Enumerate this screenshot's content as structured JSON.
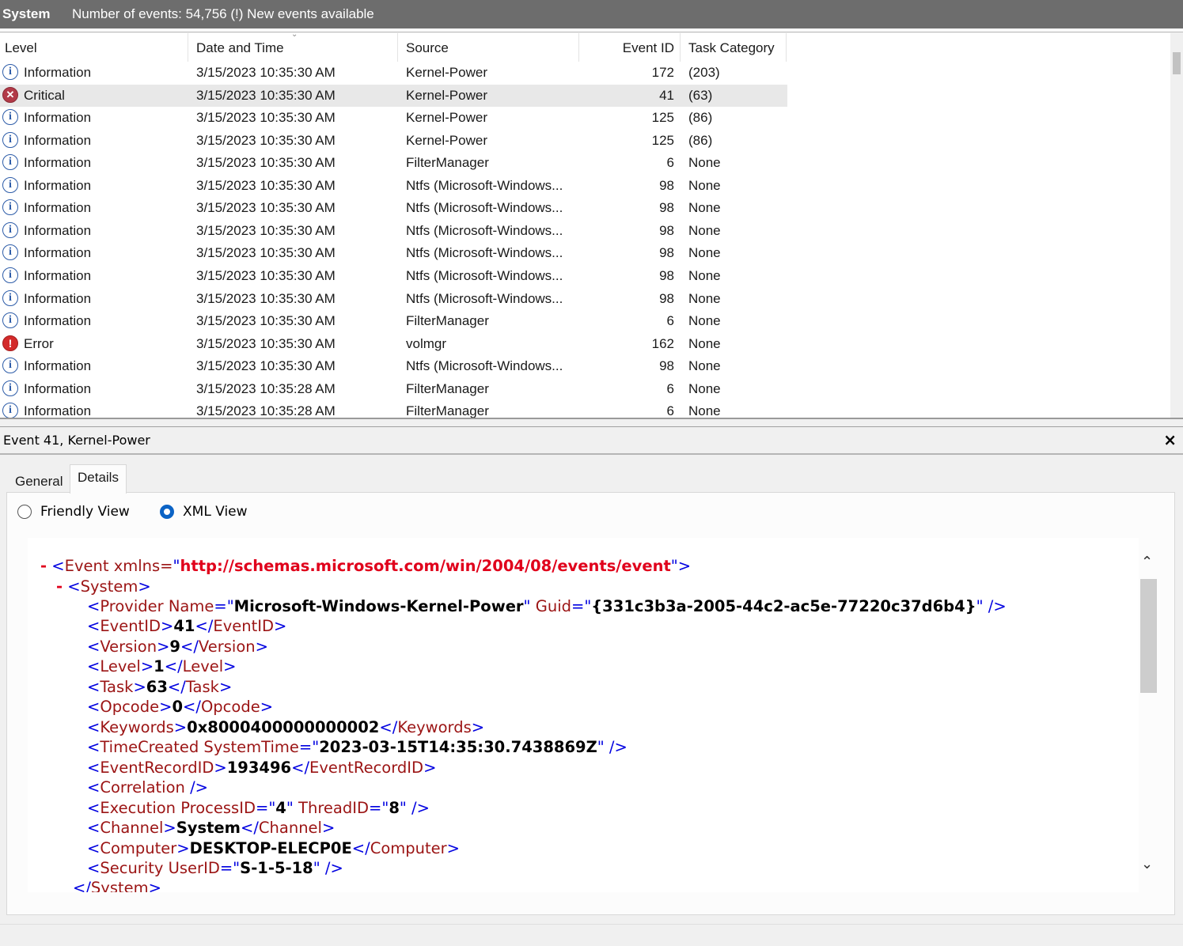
{
  "topbar": {
    "title": "System",
    "info": "Number of events: 54,756 (!) New events available"
  },
  "grid": {
    "headers": {
      "level": "Level",
      "date": "Date and Time",
      "source": "Source",
      "event_id": "Event ID",
      "task": "Task Category"
    },
    "rows": [
      {
        "level": "Information",
        "icon": "info-icon",
        "date": "3/15/2023 10:35:30 AM",
        "source": "Kernel-Power",
        "event_id": "172",
        "task": "(203)"
      },
      {
        "level": "Critical",
        "icon": "critical-icon",
        "date": "3/15/2023 10:35:30 AM",
        "source": "Kernel-Power",
        "event_id": "41",
        "task": "(63)",
        "selected": true
      },
      {
        "level": "Information",
        "icon": "info-icon",
        "date": "3/15/2023 10:35:30 AM",
        "source": "Kernel-Power",
        "event_id": "125",
        "task": "(86)"
      },
      {
        "level": "Information",
        "icon": "info-icon",
        "date": "3/15/2023 10:35:30 AM",
        "source": "Kernel-Power",
        "event_id": "125",
        "task": "(86)"
      },
      {
        "level": "Information",
        "icon": "info-icon",
        "date": "3/15/2023 10:35:30 AM",
        "source": "FilterManager",
        "event_id": "6",
        "task": "None"
      },
      {
        "level": "Information",
        "icon": "info-icon",
        "date": "3/15/2023 10:35:30 AM",
        "source": "Ntfs (Microsoft-Windows...",
        "event_id": "98",
        "task": "None"
      },
      {
        "level": "Information",
        "icon": "info-icon",
        "date": "3/15/2023 10:35:30 AM",
        "source": "Ntfs (Microsoft-Windows...",
        "event_id": "98",
        "task": "None"
      },
      {
        "level": "Information",
        "icon": "info-icon",
        "date": "3/15/2023 10:35:30 AM",
        "source": "Ntfs (Microsoft-Windows...",
        "event_id": "98",
        "task": "None"
      },
      {
        "level": "Information",
        "icon": "info-icon",
        "date": "3/15/2023 10:35:30 AM",
        "source": "Ntfs (Microsoft-Windows...",
        "event_id": "98",
        "task": "None"
      },
      {
        "level": "Information",
        "icon": "info-icon",
        "date": "3/15/2023 10:35:30 AM",
        "source": "Ntfs (Microsoft-Windows...",
        "event_id": "98",
        "task": "None"
      },
      {
        "level": "Information",
        "icon": "info-icon",
        "date": "3/15/2023 10:35:30 AM",
        "source": "Ntfs (Microsoft-Windows...",
        "event_id": "98",
        "task": "None"
      },
      {
        "level": "Information",
        "icon": "info-icon",
        "date": "3/15/2023 10:35:30 AM",
        "source": "FilterManager",
        "event_id": "6",
        "task": "None"
      },
      {
        "level": "Error",
        "icon": "error-icon",
        "date": "3/15/2023 10:35:30 AM",
        "source": "volmgr",
        "event_id": "162",
        "task": "None"
      },
      {
        "level": "Information",
        "icon": "info-icon",
        "date": "3/15/2023 10:35:30 AM",
        "source": "Ntfs (Microsoft-Windows...",
        "event_id": "98",
        "task": "None"
      },
      {
        "level": "Information",
        "icon": "info-icon",
        "date": "3/15/2023 10:35:28 AM",
        "source": "FilterManager",
        "event_id": "6",
        "task": "None"
      },
      {
        "level": "Information",
        "icon": "info-icon",
        "date": "3/15/2023 10:35:28 AM",
        "source": "FilterManager",
        "event_id": "6",
        "task": "None"
      }
    ]
  },
  "event_panel": {
    "title": "Event 41, Kernel-Power",
    "close": "×",
    "tabs": {
      "general": "General",
      "details": "Details"
    },
    "views": {
      "friendly": "Friendly View",
      "xml": "XML View",
      "selected": "xml"
    }
  },
  "xml": {
    "minus": "-",
    "event_tag": "Event xmlns=",
    "event_ns": "http://schemas.microsoft.com/win/2004/08/events/event",
    "system_tag": "System",
    "provider_name": "Microsoft-Windows-Kernel-Power",
    "provider_guid": "{331c3b3a-2005-44c2-ac5e-77220c37d6b4}",
    "event_id": "41",
    "version": "9",
    "level": "1",
    "task": "63",
    "opcode": "0",
    "keywords": "0x8000400000000002",
    "time_created": "2023-03-15T14:35:30.7438869Z",
    "record_id": "193496",
    "process_id": "4",
    "thread_id": "8",
    "channel": "System",
    "computer": "DESKTOP-ELECP0E",
    "user_id": "S-1-5-18"
  },
  "colors": {
    "tag": "#0000e0",
    "element": "#9b1414",
    "value": "#000000",
    "collapse": "#e0001b",
    "radio_selected": "#0b63c5"
  }
}
